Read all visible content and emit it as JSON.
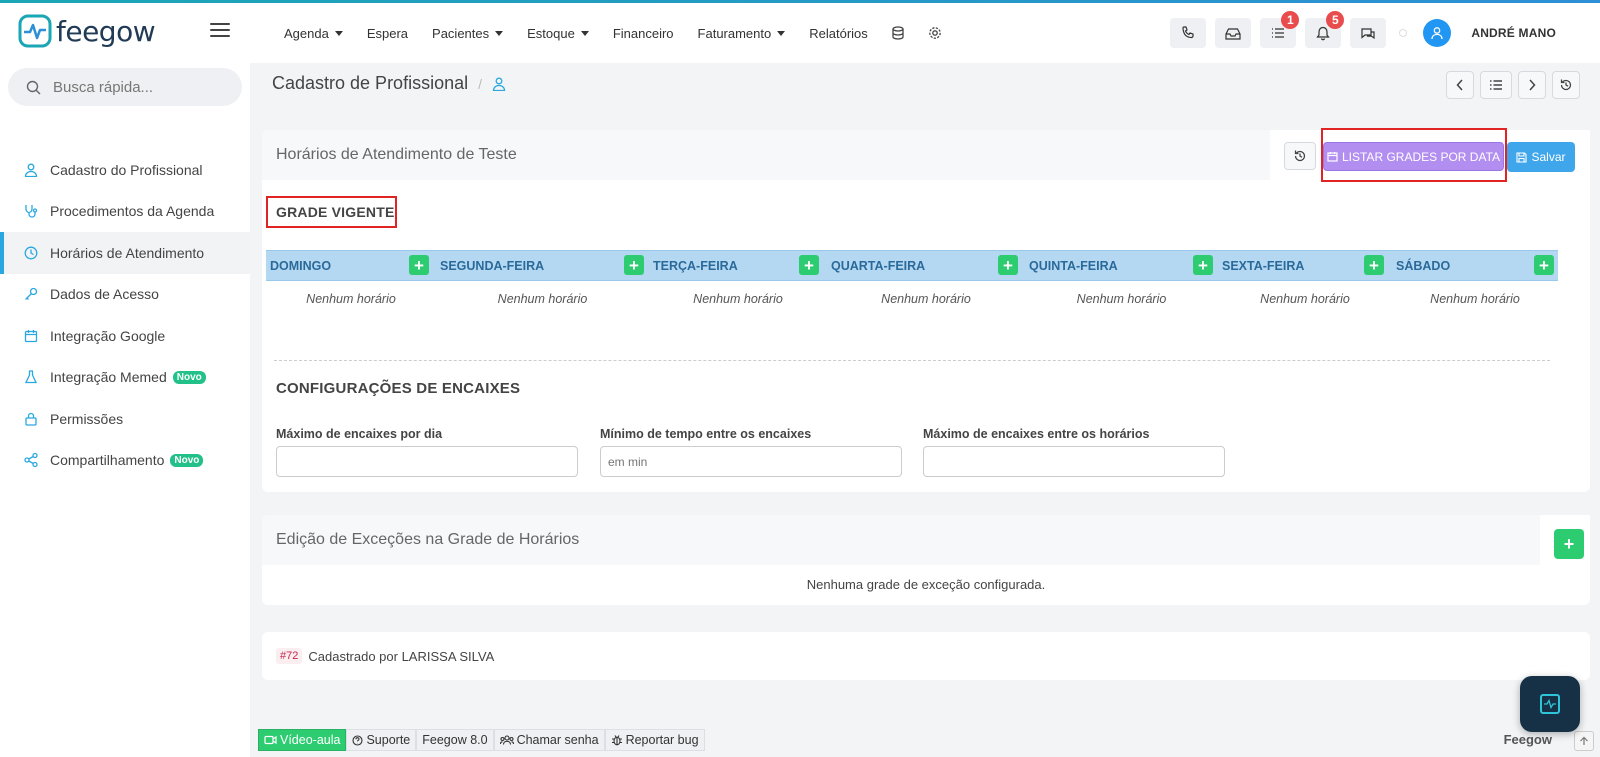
{
  "brand": {
    "name": "feegow",
    "color": "#213b57",
    "accent": "#1ba6b5"
  },
  "navbar": {
    "menu": [
      {
        "label": "Agenda",
        "dropdown": true
      },
      {
        "label": "Espera",
        "dropdown": false
      },
      {
        "label": "Pacientes",
        "dropdown": true
      },
      {
        "label": "Estoque",
        "dropdown": true
      },
      {
        "label": "Financeiro",
        "dropdown": false
      },
      {
        "label": "Faturamento",
        "dropdown": true
      },
      {
        "label": "Relatórios",
        "dropdown": false
      }
    ],
    "icons": [
      "database-icon",
      "gear-icon"
    ],
    "right_buttons": [
      {
        "icon": "phone-icon"
      },
      {
        "icon": "inbox-icon"
      },
      {
        "icon": "tasks-icon",
        "badge": "1"
      },
      {
        "icon": "bell-icon",
        "badge": "5"
      },
      {
        "icon": "chat-icon"
      }
    ],
    "user": {
      "name": "ANDRÉ MANO",
      "avatar_color": "#2196f3"
    }
  },
  "sidebar": {
    "search_placeholder": "Busca rápida...",
    "items": [
      {
        "label": "Cadastro do Profissional",
        "icon": "user-doctor-icon",
        "active": false
      },
      {
        "label": "Procedimentos da Agenda",
        "icon": "stethoscope-icon",
        "active": false
      },
      {
        "label": "Horários de Atendimento",
        "icon": "clock-icon",
        "active": true
      },
      {
        "label": "Dados de Acesso",
        "icon": "key-icon",
        "active": false
      },
      {
        "label": "Integração Google",
        "icon": "calendar-icon",
        "active": false
      },
      {
        "label": "Integração Memed",
        "icon": "flask-icon",
        "active": false,
        "badge": "Novo"
      },
      {
        "label": "Permissões",
        "icon": "lock-icon",
        "active": false
      },
      {
        "label": "Compartilhamento",
        "icon": "share-icon",
        "active": false,
        "badge": "Novo"
      }
    ]
  },
  "page": {
    "title": "Cadastro de Profissional",
    "breadcrumb_sep": "/"
  },
  "schedule_card": {
    "title": "Horários de Atendimento de Teste",
    "listar_label": "LISTAR GRADES POR DATA",
    "salvar_label": "Salvar",
    "grade_title": "GRADE VIGENTE",
    "days": [
      {
        "name": "DOMINGO",
        "empty": "Nenhum horário"
      },
      {
        "name": "SEGUNDA-FEIRA",
        "empty": "Nenhum horário"
      },
      {
        "name": "TERÇA-FEIRA",
        "empty": "Nenhum horário"
      },
      {
        "name": "QUARTA-FEIRA",
        "empty": "Nenhum horário"
      },
      {
        "name": "QUINTA-FEIRA",
        "empty": "Nenhum horário"
      },
      {
        "name": "SEXTA-FEIRA",
        "empty": "Nenhum horário"
      },
      {
        "name": "SÁBADO",
        "empty": "Nenhum horário"
      }
    ],
    "config_title": "CONFIGURAÇÕES DE ENCAIXES",
    "fields": [
      {
        "label": "Máximo de encaixes por dia",
        "value": "",
        "placeholder": ""
      },
      {
        "label": "Mínimo de tempo entre os encaixes",
        "value": "",
        "placeholder": "em min"
      },
      {
        "label": "Máximo de encaixes entre os horários",
        "value": "",
        "placeholder": ""
      }
    ]
  },
  "exceptions_card": {
    "title": "Edição de Exceções na Grade de Horários",
    "empty": "Nenhuma grade de exceção configurada."
  },
  "meta_card": {
    "id_tag": "#72",
    "text": "Cadastrado por LARISSA SILVA"
  },
  "footer": {
    "video": "Vídeo-aula",
    "suporte": "Suporte",
    "version": "Feegow 8.0",
    "chamar": "Chamar senha",
    "bug": "Reportar bug",
    "brand": "Feegow"
  },
  "colors": {
    "day_header_bg": "#b5d8f2",
    "add_green": "#2ecc71",
    "listar_purple": "#b38ef1",
    "salvar_blue": "#3fa6eb",
    "highlight_red": "#e02424"
  }
}
